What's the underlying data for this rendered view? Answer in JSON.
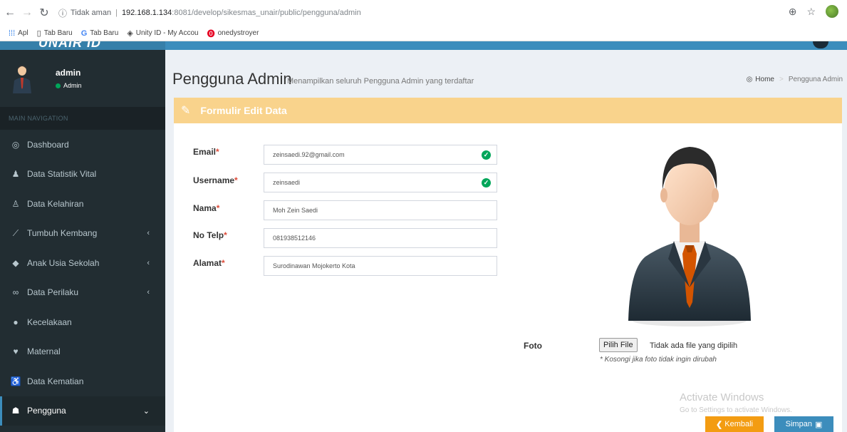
{
  "browser": {
    "security_label": "Tidak aman",
    "url_host": "192.168.1.134",
    "url_path": ":8081/develop/sikesmas_unair/public/pengguna/admin",
    "bookmarks": [
      {
        "label": "Apl",
        "icon": "apps-grid-icon"
      },
      {
        "label": "Tab Baru",
        "icon": "page-icon"
      },
      {
        "label": "Tab Baru",
        "icon": "google-icon"
      },
      {
        "label": "Unity ID - My Accou",
        "icon": "unity-icon"
      },
      {
        "label": "onedystroyer",
        "icon": "pinterest-icon"
      }
    ]
  },
  "app": {
    "logo_text": "UNAIR ID"
  },
  "sidebar": {
    "user_name": "admin",
    "user_role": "Admin",
    "nav_header": "MAIN NAVIGATION",
    "items": [
      {
        "label": "Dashboard",
        "icon": "dashboard-icon",
        "chevron": ""
      },
      {
        "label": "Data Statistik Vital",
        "icon": "user-icon",
        "chevron": ""
      },
      {
        "label": "Data Kelahiran",
        "icon": "child-icon",
        "chevron": ""
      },
      {
        "label": "Tumbuh Kembang",
        "icon": "line-chart-icon",
        "chevron": "‹"
      },
      {
        "label": "Anak Usia Sekolah",
        "icon": "graduation-cap-icon",
        "chevron": "‹"
      },
      {
        "label": "Data Perilaku",
        "icon": "binoculars-icon",
        "chevron": "‹"
      },
      {
        "label": "Kecelakaan",
        "icon": "info-icon",
        "chevron": ""
      },
      {
        "label": "Maternal",
        "icon": "heartbeat-icon",
        "chevron": ""
      },
      {
        "label": "Data Kematian",
        "icon": "blind-icon",
        "chevron": ""
      },
      {
        "label": "Pengguna",
        "icon": "users-icon",
        "chevron": "⌄"
      }
    ]
  },
  "content": {
    "title": "Pengguna Admin",
    "subtitle": "Menampilkan seluruh Pengguna Admin yang terdaftar",
    "breadcrumb_home": "Home",
    "breadcrumb_current": "Pengguna Admin"
  },
  "form": {
    "box_title": "Formulir Edit Data",
    "fields": [
      {
        "label": "Email",
        "value": "zeinsaedi.92@gmail.com",
        "valid": true
      },
      {
        "label": "Username",
        "value": "zeinsaedi",
        "valid": true
      },
      {
        "label": "Nama",
        "value": "Moh Zein Saedi",
        "valid": false
      },
      {
        "label": "No Telp",
        "value": "081938512146",
        "valid": false
      },
      {
        "label": "Alamat",
        "value": "Surodinawan Mojokerto Kota",
        "valid": false
      }
    ],
    "required_mark": "*",
    "foto_label": "Foto",
    "file_button": "Pilih File",
    "file_status": "Tidak ada file yang dipilih",
    "file_help": "* Kosongi jika foto tidak ingin dirubah",
    "back_button": "Kembali",
    "save_button": "Simpan"
  },
  "watermark": {
    "line1": "Activate Windows",
    "line2": "Go to Settings to activate Windows."
  },
  "colors": {
    "header_blue": "#3c8dbc",
    "sidebar_dark": "#222d32",
    "box_header_orange": "#f9d38c",
    "back_button_orange": "#f39c12",
    "valid_green": "#00a65a"
  }
}
